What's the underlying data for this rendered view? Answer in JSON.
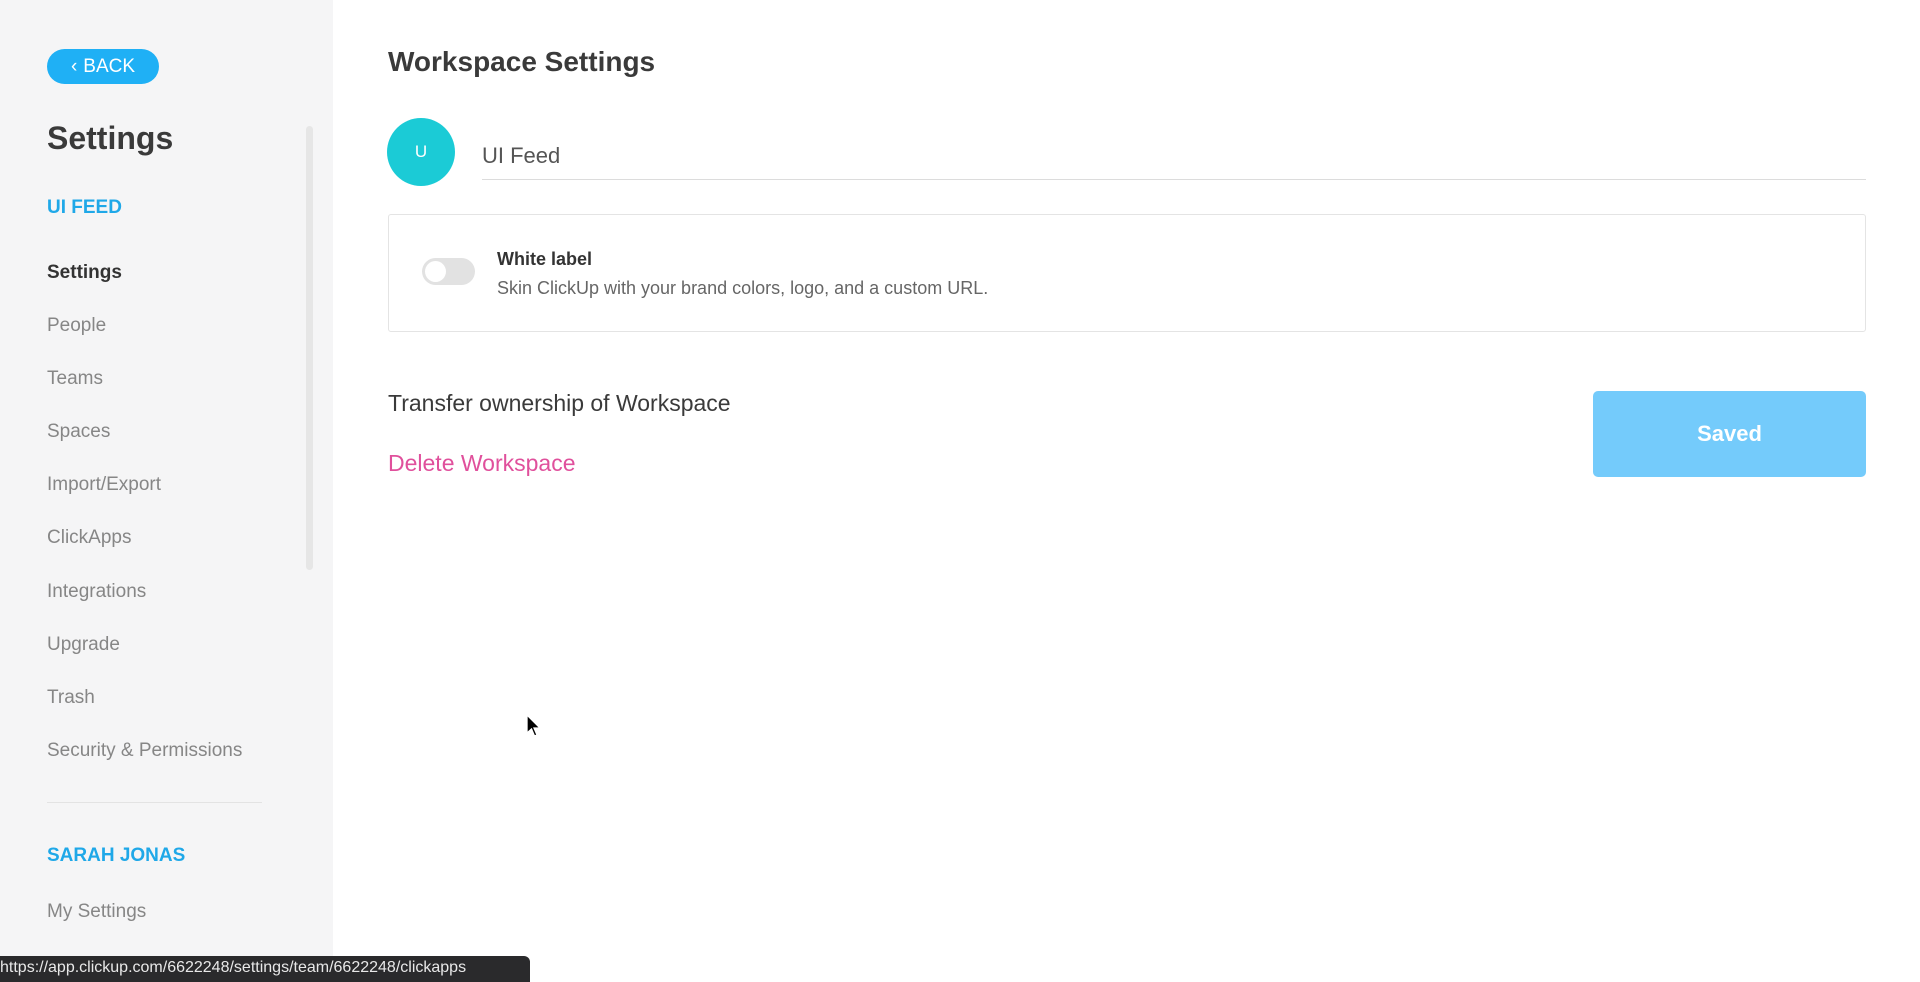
{
  "sidebar": {
    "back_label": "BACK",
    "title": "Settings",
    "workspace_section": "UI FEED",
    "items": [
      {
        "label": "Settings",
        "active": true
      },
      {
        "label": "People"
      },
      {
        "label": "Teams"
      },
      {
        "label": "Spaces"
      },
      {
        "label": "Import/Export"
      },
      {
        "label": "ClickApps"
      },
      {
        "label": "Integrations"
      },
      {
        "label": "Upgrade"
      },
      {
        "label": "Trash"
      },
      {
        "label": "Security & Permissions"
      }
    ],
    "user_section": "SARAH JONAS",
    "user_items": [
      {
        "label": "My Settings"
      }
    ]
  },
  "main": {
    "title": "Workspace Settings",
    "avatar_initial": "U",
    "workspace_name": "UI Feed",
    "white_label": {
      "title": "White label",
      "description": "Skin ClickUp with your brand colors, logo, and a custom URL.",
      "enabled": false
    },
    "transfer_label": "Transfer ownership of Workspace",
    "delete_label": "Delete Workspace",
    "saved_label": "Saved"
  },
  "status_url": "https://app.clickup.com/6622248/settings/team/6622248/clickapps",
  "colors": {
    "accent": "#1fb0f5",
    "avatar": "#1bcbd6",
    "danger": "#e0509c",
    "saved": "#74cbfb"
  }
}
